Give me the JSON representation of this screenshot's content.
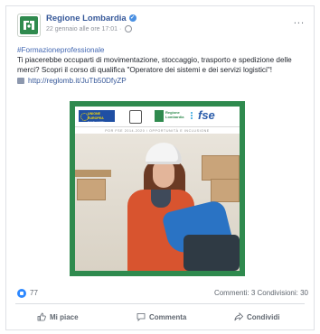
{
  "post": {
    "page_name": "Regione Lombardia",
    "timestamp": "22 gennaio alle ore 17:01",
    "separator": "·",
    "more_label": "...",
    "hashtag": "#Formazioneprofessionale",
    "body": "Ti piacerebbe occuparti di movimentazione, stoccaggio, trasporto e spedizione delle merci? Scopri il corso di qualifica \"Operatore dei sistemi e dei servizi logistici\"!",
    "link_text": "http://reglomb.it/JuTb50DfyZP"
  },
  "image": {
    "eu_text": "UNIONE EUROPEA",
    "eu_subtext": "Fondo sociale europeo",
    "region_logo_text": "Regione Lombardia",
    "fse_text": "fse",
    "strip_text": "POR FSE 2014-2020 / OPPORTUNITÀ E INCLUSIONE"
  },
  "stats": {
    "likes": "77",
    "counts": "Commenti: 3   Condivisioni: 30"
  },
  "actions": {
    "like": "Mi piace",
    "comment": "Commenta",
    "share": "Condividi"
  },
  "colors": {
    "link": "#365899",
    "hashtag": "#4267b2",
    "frame_green": "#2f8a4e",
    "like_blue": "#2d88ff"
  },
  "icons": {
    "avatar": "regione-lombardia-logo",
    "verified": "verified-badge-icon",
    "globe": "globe-icon",
    "link": "link-icon",
    "like": "thumbs-up-icon",
    "comment": "comment-icon",
    "share": "share-icon"
  }
}
